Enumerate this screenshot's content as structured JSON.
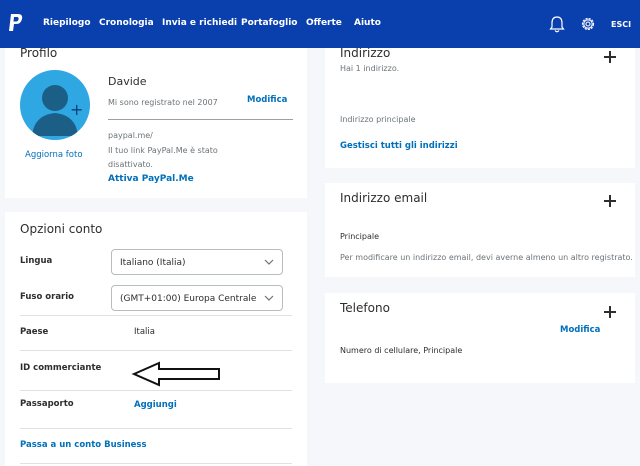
{
  "nav": {
    "items": [
      "Riepilogo",
      "Cronologia",
      "Invia e richiedi",
      "Portafoglio",
      "Offerte",
      "Aiuto"
    ],
    "logout": "ESCI"
  },
  "profile": {
    "title": "Profilo",
    "name": "Davide",
    "member_since": "Mi sono registrato nel 2007",
    "edit": "Modifica",
    "update_photo": "Aggiorna foto",
    "paypalme_line1": "paypal.me/",
    "paypalme_line2": "Il tuo link PayPal.Me è stato",
    "paypalme_line3": "disattivato.",
    "activate": "Attiva PayPal.Me"
  },
  "options": {
    "title": "Opzioni conto",
    "language_label": "Lingua",
    "language_value": "Italiano (Italia)",
    "timezone_label": "Fuso orario",
    "timezone_value": "(GMT+01:00) Europa Centrale",
    "country_label": "Paese",
    "country_value": "Italia",
    "merchant_label": "ID commerciante",
    "passport_label": "Passaporto",
    "passport_add": "Aggiungi",
    "business_link": "Passa a un conto Business"
  },
  "address": {
    "title": "Indirizzo",
    "count": "Hai 1 indirizzo.",
    "primary": "Indirizzo principale",
    "manage": "Gestisci tutti gli indirizzi"
  },
  "email": {
    "title": "Indirizzo email",
    "primary": "Principale",
    "note": "Per modificare un indirizzo email, devi averne almeno un altro registrato."
  },
  "phone": {
    "title": "Telefono",
    "edit": "Modifica",
    "desc": "Numero di cellulare, Principale"
  },
  "colors": {
    "nav_bg": "#0a3fae",
    "link": "#0070ba",
    "avatar": "#2fa7e2"
  }
}
